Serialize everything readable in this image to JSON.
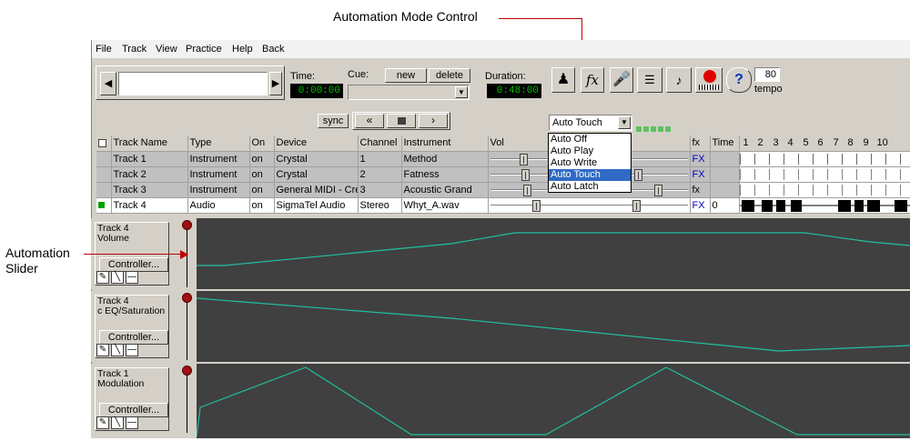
{
  "callouts": {
    "automation_mode": "Automation Mode Control",
    "automation_slider_line1": "Automation",
    "automation_slider_line2": "Slider"
  },
  "menu": [
    "File",
    "Track",
    "View",
    "Practice",
    "Help",
    "Back"
  ],
  "transport": {
    "time_label": "Time:",
    "time_value": "0:00:00",
    "cue_label": "Cue:",
    "cue_new": "new",
    "cue_delete": "delete",
    "duration_label": "Duration:",
    "duration_value": "0:48:00",
    "sync_label": "sync",
    "tempo_value": "80",
    "tempo_label": "tempo"
  },
  "automation_select": {
    "value": "Auto Touch",
    "options": [
      "Auto Off",
      "Auto Play",
      "Auto Write",
      "Auto Touch",
      "Auto Latch"
    ],
    "selected_index": 3
  },
  "track_table": {
    "headers": [
      "Track Name",
      "Type",
      "On",
      "Device",
      "Channel",
      "Instrument",
      "Vol",
      "fx",
      "Time"
    ],
    "ruler": [
      "1",
      "2",
      "3",
      "4",
      "5",
      "6",
      "7",
      "8",
      "9",
      "10"
    ],
    "rows": [
      {
        "name": "Track 1",
        "type": "Instrument",
        "on": "on",
        "device": "Crystal",
        "channel": "1",
        "instrument": "Method",
        "fx": "FX",
        "time": ""
      },
      {
        "name": "Track 2",
        "type": "Instrument",
        "on": "on",
        "device": "Crystal",
        "channel": "2",
        "instrument": "Fatness",
        "fx": "FX",
        "time": ""
      },
      {
        "name": "Track 3",
        "type": "Instrument",
        "on": "on",
        "device": "General MIDI - Cre",
        "channel": "3",
        "instrument": "Acoustic Grand",
        "fx": "fx",
        "time": ""
      },
      {
        "name": "Track 4",
        "type": "Audio",
        "on": "on",
        "device": "SigmaTel Audio",
        "channel": "Stereo",
        "instrument": "Whyt_A.wav",
        "fx": "FX",
        "time": "0"
      }
    ]
  },
  "lanes": [
    {
      "line1": "Track 4",
      "line2": "Volume",
      "controller": "Controller..."
    },
    {
      "line1": "Track 4",
      "line2": "c EQ/Saturation",
      "controller": "Controller..."
    },
    {
      "line1": "Track 1",
      "line2": "Modulation",
      "controller": "Controller..."
    }
  ],
  "colors": {
    "envelope": "#20c0a0",
    "lane_bg": "#404040",
    "record": "#e00000",
    "lcd_text": "#00c000"
  }
}
